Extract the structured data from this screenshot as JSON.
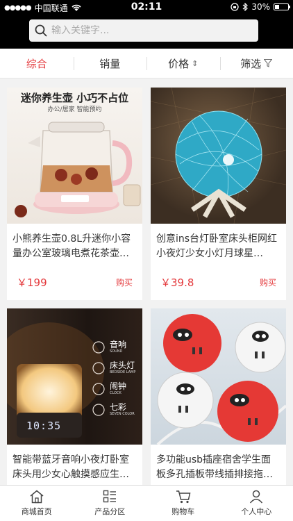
{
  "status": {
    "carrier": "中国联通",
    "time": "02:11",
    "battery_text": "30%",
    "battery_level": 0.3
  },
  "search": {
    "placeholder": "输入关键字..."
  },
  "tabs": [
    {
      "label": "综合",
      "active": true
    },
    {
      "label": "销量"
    },
    {
      "label": "价格"
    },
    {
      "label": "筛选"
    }
  ],
  "products": [
    {
      "banner": "迷你养生壶 小巧不占位",
      "subbanner": "办公/居家 智能预约",
      "title": "小熊养生壶0.8L升迷你小容量办公室玻璃电煮花茶壶…",
      "price": "￥199",
      "buy": "购买"
    },
    {
      "title": "创意ins台灯卧室床头柜网红小夜灯少女小灯月球星…",
      "price": "￥39.8",
      "buy": "购买"
    },
    {
      "features": [
        {
          "label": "音响",
          "en": "SOUND"
        },
        {
          "label": "床头灯",
          "en": "BEDSIDE LAMP"
        },
        {
          "label": "闹钟",
          "en": "CLOCK"
        },
        {
          "label": "七彩",
          "en": "SEVEN COLOR"
        }
      ],
      "clock": "10:35",
      "title": "智能带蓝牙音响小夜灯卧室床头用少女心触摸感应生…",
      "price": "",
      "buy": ""
    },
    {
      "title": "多功能usb插座宿舍学生面板多孔插板带线插排接拖…",
      "price": "",
      "buy": ""
    }
  ],
  "tabbar": [
    {
      "label": "商城首页",
      "icon": "home-icon"
    },
    {
      "label": "产品分区",
      "icon": "category-icon"
    },
    {
      "label": "购物车",
      "icon": "cart-icon"
    },
    {
      "label": "个人中心",
      "icon": "user-icon"
    }
  ],
  "colors": {
    "accent": "#e4393c"
  }
}
